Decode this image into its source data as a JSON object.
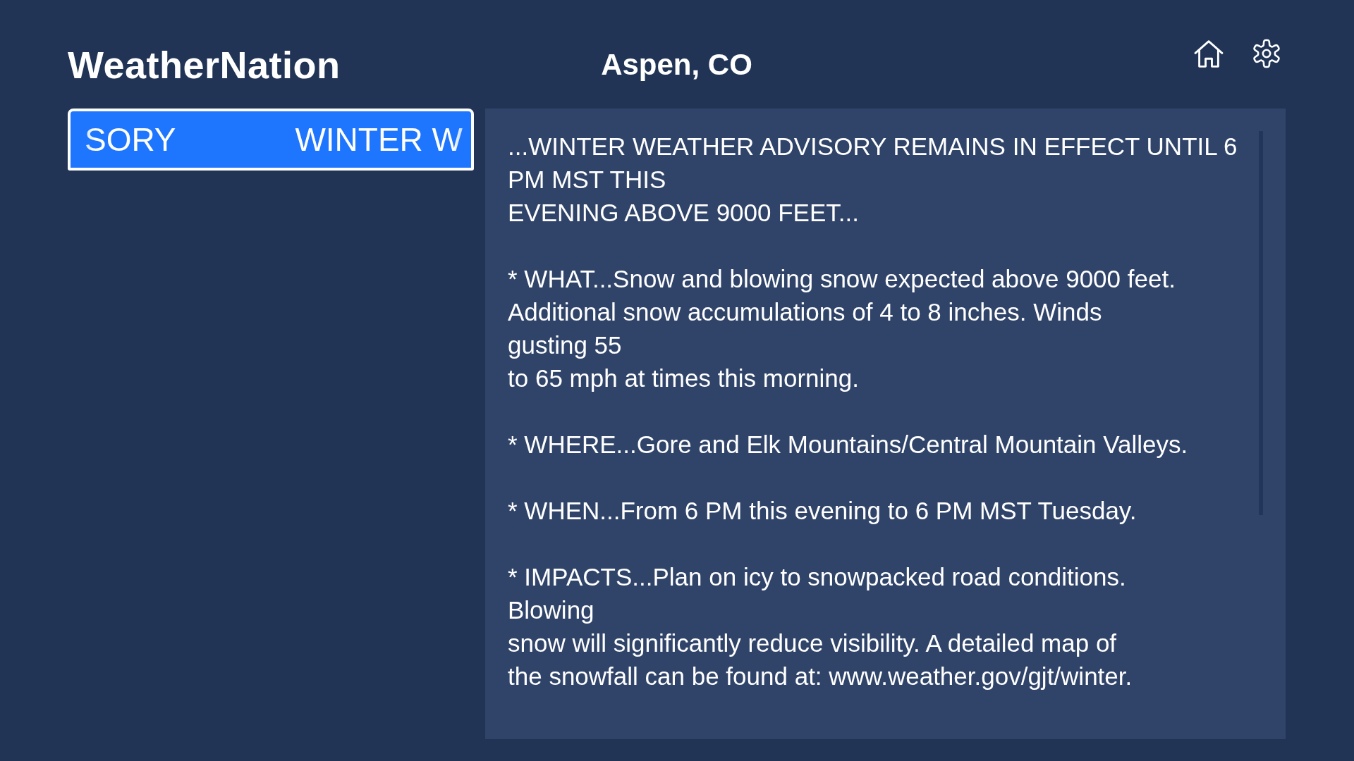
{
  "header": {
    "logo": "WeatherNation",
    "location": "Aspen, CO"
  },
  "alerts": [
    {
      "ticker": [
        "SORY",
        "WINTER W"
      ],
      "selected": true
    }
  ],
  "bulletin": {
    "paragraphs": [
      {
        "lines": [
          "...WINTER WEATHER ADVISORY REMAINS IN EFFECT UNTIL 6",
          "PM MST THIS",
          "EVENING ABOVE 9000 FEET..."
        ]
      },
      {
        "lines": [
          "* WHAT...Snow and blowing snow expected above 9000 feet.",
          "Additional snow accumulations of 4 to 8 inches. Winds",
          "gusting 55",
          "to 65 mph at times this morning."
        ]
      },
      {
        "lines": [
          "* WHERE...Gore and Elk Mountains/Central Mountain Valleys."
        ]
      },
      {
        "lines": [
          "* WHEN...From 6 PM this evening to 6 PM MST Tuesday."
        ]
      },
      {
        "lines": [
          "* IMPACTS...Plan on icy to snowpacked road conditions.",
          "Blowing",
          "snow will significantly reduce visibility. A detailed map of",
          "the snowfall can be found at: www.weather.gov/gjt/winter."
        ]
      }
    ]
  }
}
